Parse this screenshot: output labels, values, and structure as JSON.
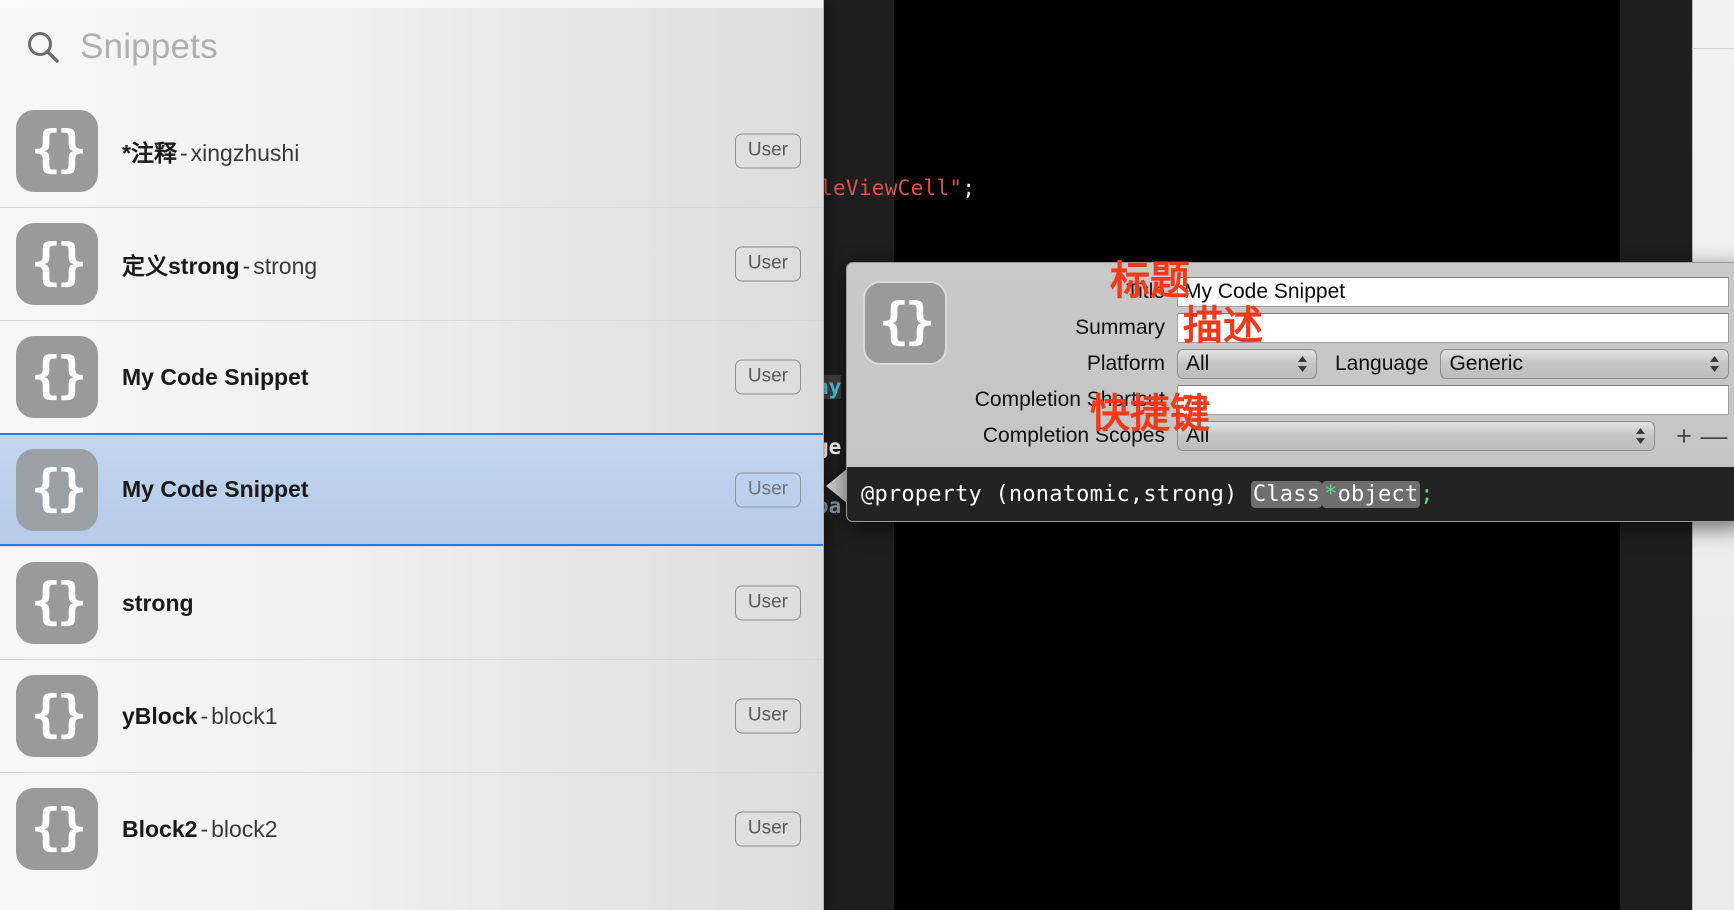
{
  "colors": {
    "selection_blue": "#1a7ef4",
    "selection_fill": "#bdd1ec",
    "annotation_red": "#f4391b",
    "editor_black": "#000000",
    "popover_gray": "#c7c7c7",
    "code_bg": "#232323",
    "token_green": "#4ce07a",
    "string_red": "#d9534f",
    "keyword_cyan": "#4ec9e8"
  },
  "snippets_panel": {
    "search": {
      "placeholder": "Snippets",
      "value": "",
      "icon": "search-icon"
    },
    "items": [
      {
        "title": "*注释",
        "separator": "-",
        "subtitle": "xingzhushi",
        "badge": "User",
        "icon": "braces-icon",
        "selected": false
      },
      {
        "title": "定义strong",
        "separator": "-",
        "subtitle": "strong",
        "badge": "User",
        "icon": "braces-icon",
        "selected": false
      },
      {
        "title": "My Code Snippet",
        "separator": "",
        "subtitle": "",
        "badge": "User",
        "icon": "braces-icon",
        "selected": false
      },
      {
        "title": "My Code Snippet",
        "separator": "",
        "subtitle": "",
        "badge": "User",
        "icon": "braces-icon",
        "selected": true
      },
      {
        "title": "strong",
        "separator": "",
        "subtitle": "",
        "badge": "User",
        "icon": "braces-icon",
        "selected": false
      },
      {
        "title": "yBlock",
        "separator": "-",
        "subtitle": "block1",
        "badge": "User",
        "icon": "braces-icon",
        "selected": false
      },
      {
        "title": "Block2",
        "separator": "-",
        "subtitle": "block2",
        "badge": "User",
        "icon": "braces-icon",
        "selected": false
      }
    ]
  },
  "edit_popover": {
    "icon": "braces-icon",
    "fields": {
      "title_label": "Title",
      "title_value": "My Code Snippet",
      "title_placeholder": "Title",
      "summary_label": "Summary",
      "summary_value": "",
      "summary_placeholder": "",
      "platform_label": "Platform",
      "platform_value": "All",
      "language_label": "Language",
      "language_value": "Generic",
      "shortcut_label": "Completion Shortcut",
      "shortcut_value": "",
      "shortcut_placeholder": "",
      "scopes_label": "Completion Scopes",
      "scopes_value": "All"
    },
    "buttons": {
      "add": "+",
      "remove": "—"
    },
    "code": {
      "prefix": "@property (nonatomic,strong) ",
      "token_type": "Class",
      "star": "*",
      "token_name": "object",
      "terminator": ";"
    }
  },
  "editor_background": {
    "code_line": "leViewCell\"",
    "code_line_semicolon": ";",
    "peek_words": [
      {
        "text": "ay",
        "kind": "keyword"
      },
      {
        "text": "ge",
        "kind": "white"
      },
      {
        "text": "oa",
        "kind": "dim"
      }
    ]
  },
  "annotations": [
    {
      "id": "annot-title",
      "text": "标题",
      "meaning": "title"
    },
    {
      "id": "annot-desc",
      "text": "描述",
      "meaning": "description"
    },
    {
      "id": "annot-short",
      "text": "快捷键",
      "meaning": "shortcut-key"
    }
  ]
}
